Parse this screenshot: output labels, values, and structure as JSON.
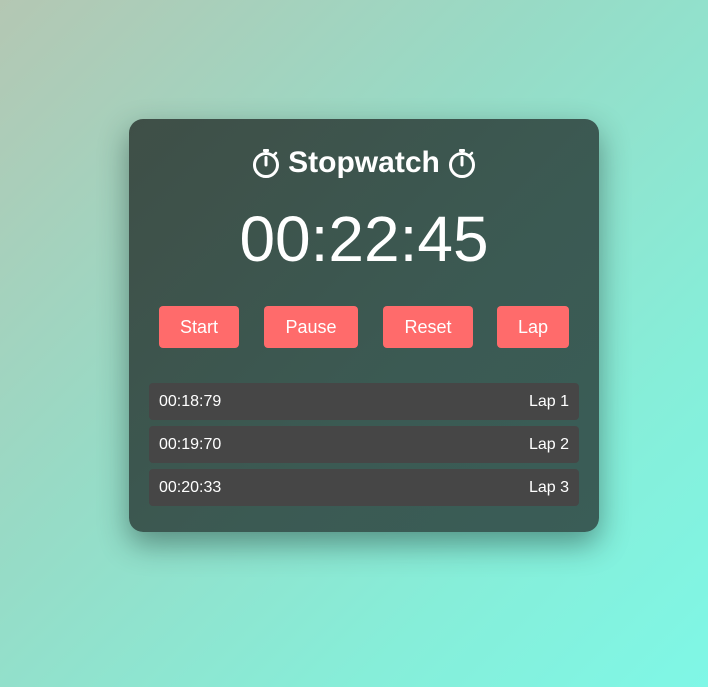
{
  "app": {
    "title": "Stopwatch",
    "title_icon": "stopwatch-icon"
  },
  "display": {
    "time": "00:22:45"
  },
  "controls": {
    "start_label": "Start",
    "pause_label": "Pause",
    "reset_label": "Reset",
    "lap_label": "Lap"
  },
  "laps": [
    {
      "time": "00:18:79",
      "label": "Lap 1"
    },
    {
      "time": "00:19:70",
      "label": "Lap 2"
    },
    {
      "time": "00:20:33",
      "label": "Lap 3"
    }
  ],
  "colors": {
    "accent": "#ff6b6b",
    "card": "#3d5750",
    "lap_row": "#464646"
  }
}
